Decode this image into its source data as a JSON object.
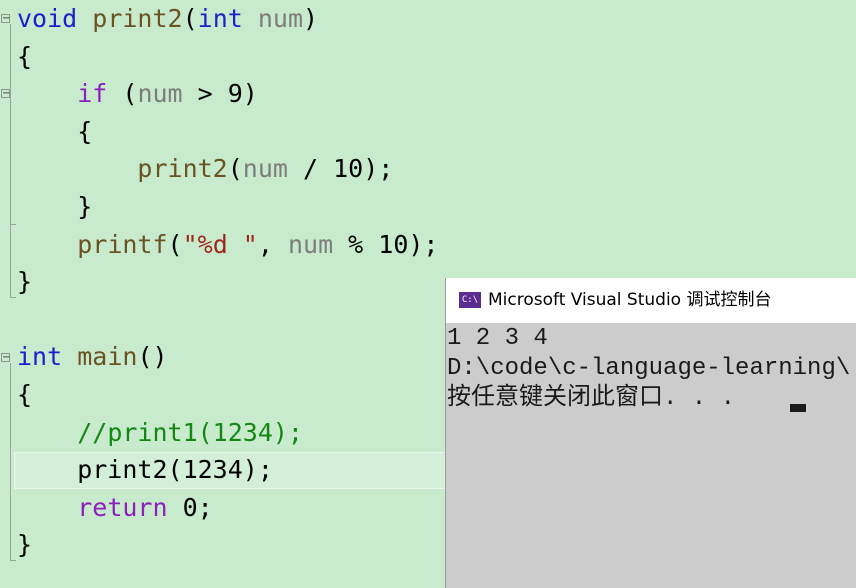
{
  "editor": {
    "lines": [
      [
        {
          "t": "void",
          "c": "kw"
        },
        {
          "t": " "
        },
        {
          "t": "print2",
          "c": "fn"
        },
        {
          "t": "("
        },
        {
          "t": "int",
          "c": "kw"
        },
        {
          "t": " "
        },
        {
          "t": "num",
          "c": "pm"
        },
        {
          "t": ")"
        }
      ],
      [
        {
          "t": "{"
        }
      ],
      [
        {
          "t": "    "
        },
        {
          "t": "if",
          "c": "kw2"
        },
        {
          "t": " ("
        },
        {
          "t": "num",
          "c": "pm"
        },
        {
          "t": " > 9)"
        }
      ],
      [
        {
          "t": "    {"
        }
      ],
      [
        {
          "t": "        "
        },
        {
          "t": "print2",
          "c": "fn"
        },
        {
          "t": "("
        },
        {
          "t": "num",
          "c": "pm"
        },
        {
          "t": " / 10);"
        }
      ],
      [
        {
          "t": "    }"
        }
      ],
      [
        {
          "t": "    "
        },
        {
          "t": "printf",
          "c": "fn"
        },
        {
          "t": "("
        },
        {
          "t": "\"%d \"",
          "c": "str"
        },
        {
          "t": ", "
        },
        {
          "t": "num",
          "c": "pm"
        },
        {
          "t": " % 10);"
        }
      ],
      [
        {
          "t": "}"
        }
      ],
      [],
      [
        {
          "t": "int",
          "c": "kw"
        },
        {
          "t": " "
        },
        {
          "t": "main",
          "c": "fn"
        },
        {
          "t": "()"
        }
      ],
      [
        {
          "t": "{"
        }
      ],
      [
        {
          "t": "    "
        },
        {
          "t": "//print1(1234);",
          "c": "cm"
        }
      ],
      [
        {
          "t": "    print2(1234);"
        }
      ],
      [
        {
          "t": "    "
        },
        {
          "t": "return",
          "c": "kw2"
        },
        {
          "t": " 0;"
        }
      ],
      [
        {
          "t": "}"
        }
      ]
    ]
  },
  "console": {
    "title": "Microsoft Visual Studio 调试控制台",
    "icon_label": "C:\\",
    "output": [
      "1 2 3 4",
      "D:\\code\\c-language-learning\\",
      "按任意键关闭此窗口. . ."
    ]
  },
  "colors": {
    "editor_background": "#c7ebcc",
    "keyword": "#1e1ecf",
    "control_keyword": "#8d1fbd",
    "function": "#6b5323",
    "parameter": "#7d7d7d",
    "string": "#a0261c",
    "comment": "#148714",
    "console_background": "#cccccc",
    "console_icon": "#5c2d91"
  },
  "icons": [
    "collapse-icon",
    "console-app-icon",
    "text-cursor"
  ]
}
